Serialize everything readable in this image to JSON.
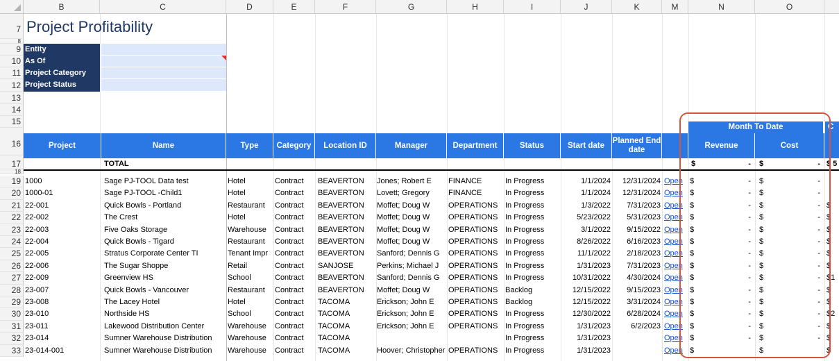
{
  "columns": [
    "B",
    "C",
    "D",
    "E",
    "F",
    "G",
    "H",
    "I",
    "J",
    "K",
    "M",
    "N",
    "O"
  ],
  "title": "Project Profitability",
  "filters": [
    "Entity",
    "As Of",
    "Project Category",
    "Project Status"
  ],
  "row_numbers": [
    "7",
    "8",
    "9",
    "10",
    "11",
    "12",
    "13",
    "14",
    "15",
    "16",
    "17",
    "18",
    "19",
    "20",
    "21",
    "22",
    "23",
    "24",
    "25",
    "26",
    "27",
    "28",
    "29",
    "30",
    "31",
    "32",
    "33"
  ],
  "group_header": "Month To Date",
  "group_header_next": "C",
  "headers": {
    "project": "Project",
    "name": "Name",
    "type": "Type",
    "category": "Category",
    "location": "Location ID",
    "manager": "Manager",
    "department": "Department",
    "status": "Status",
    "start": "Start date",
    "planned_end": "Planned End date",
    "revenue": "Revenue",
    "cost": "Cost"
  },
  "total_row": {
    "label": "TOTAL",
    "rev_sym": "$",
    "rev_val": "-",
    "cost_sym": "$",
    "cost_val": "-",
    "next": "$ 5"
  },
  "rows": [
    [
      "1000",
      "Sage PJ-TOOL Data test",
      "Hotel",
      "Contract",
      "BEAVERTON",
      "Jones; Robert E",
      "FINANCE",
      "In Progress",
      "1/1/2024",
      "12/31/2024",
      "Open",
      "$",
      "-",
      "$",
      "-",
      ""
    ],
    [
      "1000-01",
      "Sage PJ-TOOL -Child1",
      "Hotel",
      "Contract",
      "BEAVERTON",
      "Lovett; Gregory",
      "FINANCE",
      "In Progress",
      "1/1/2024",
      "12/31/2024",
      "Open",
      "$",
      "-",
      "$",
      "-",
      ""
    ],
    [
      "22-001",
      "Quick Bowls - Portland",
      "Restaurant",
      "Contract",
      "BEAVERTON",
      "Moffet; Doug W",
      "OPERATIONS",
      "In Progress",
      "1/3/2022",
      "7/31/2023",
      "Open",
      "$",
      "-",
      "$",
      "-",
      "$"
    ],
    [
      "22-002",
      "The Crest",
      "Hotel",
      "Contract",
      "BEAVERTON",
      "Moffet; Doug W",
      "OPERATIONS",
      "In Progress",
      "5/23/2022",
      "5/31/2023",
      "Open",
      "$",
      "-",
      "$",
      "-",
      "$"
    ],
    [
      "22-003",
      "Five Oaks Storage",
      "Warehouse",
      "Contract",
      "BEAVERTON",
      "Moffet; Doug W",
      "OPERATIONS",
      "In Progress",
      "3/1/2022",
      "9/15/2022",
      "Open",
      "$",
      "-",
      "$",
      "-",
      "$"
    ],
    [
      "22-004",
      "Quick Bowls - Tigard",
      "Restaurant",
      "Contract",
      "BEAVERTON",
      "Moffet; Doug W",
      "OPERATIONS",
      "In Progress",
      "8/26/2022",
      "6/16/2023",
      "Open",
      "$",
      "-",
      "$",
      "-",
      "$"
    ],
    [
      "22-005",
      "Stratus Corporate Center TI",
      "Tenant Impr",
      "Contract",
      "BEAVERTON",
      "Sanford; Dennis G",
      "OPERATIONS",
      "In Progress",
      "11/1/2022",
      "2/18/2023",
      "Open",
      "$",
      "-",
      "$",
      "-",
      "$"
    ],
    [
      "22-006",
      "The Sugar Shoppe",
      "Retail",
      "Contract",
      "SANJOSE",
      "Perkins; Michael J",
      "OPERATIONS",
      "In Progress",
      "1/31/2023",
      "7/31/2023",
      "Open",
      "$",
      "-",
      "$",
      "-",
      "$"
    ],
    [
      "22-009",
      "Greenview HS",
      "School",
      "Contract",
      "BEAVERTON",
      "Sanford; Dennis G",
      "OPERATIONS",
      "In Progress",
      "10/31/2022",
      "4/30/2024",
      "Open",
      "$",
      "-",
      "$",
      "-",
      "$1"
    ],
    [
      "23-007",
      "Quick Bowls - Vancouver",
      "Restaurant",
      "Contract",
      "BEAVERTON",
      "Moffet; Doug W",
      "OPERATIONS",
      "Backlog",
      "12/15/2022",
      "9/15/2023",
      "Open",
      "$",
      "-",
      "$",
      "-",
      "$"
    ],
    [
      "23-008",
      "The Lacey Hotel",
      "Hotel",
      "Contract",
      "TACOMA",
      "Erickson; John E",
      "OPERATIONS",
      "Backlog",
      "12/15/2022",
      "3/31/2024",
      "Open",
      "$",
      "-",
      "$",
      "-",
      "$"
    ],
    [
      "23-010",
      "Northside HS",
      "School",
      "Contract",
      "TACOMA",
      "Erickson; John E",
      "OPERATIONS",
      "In Progress",
      "12/30/2022",
      "6/28/2024",
      "Open",
      "$",
      "-",
      "$",
      "-",
      "$2"
    ],
    [
      "23-011",
      "Lakewood Distribution Center",
      "Warehouse",
      "Contract",
      "TACOMA",
      "Erickson; John E",
      "OPERATIONS",
      "In Progress",
      "1/31/2023",
      "6/2/2023",
      "Open",
      "$",
      "-",
      "$",
      "-",
      "$"
    ],
    [
      "23-014",
      "Sumner Warehouse Distribution",
      "Warehouse",
      "Contract",
      "TACOMA",
      "",
      "",
      "In Progress",
      "1/31/2023",
      "",
      "Open",
      "$",
      "-",
      "$",
      "-",
      "$"
    ],
    [
      "23-014-001",
      "Sumner Warehouse Distribution",
      "Warehouse",
      "Contract",
      "TACOMA",
      "Hoover; Christopher",
      "OPERATIONS",
      "In Progress",
      "1/31/2023",
      "",
      "Open",
      "$",
      "",
      "$",
      "",
      "$"
    ]
  ]
}
